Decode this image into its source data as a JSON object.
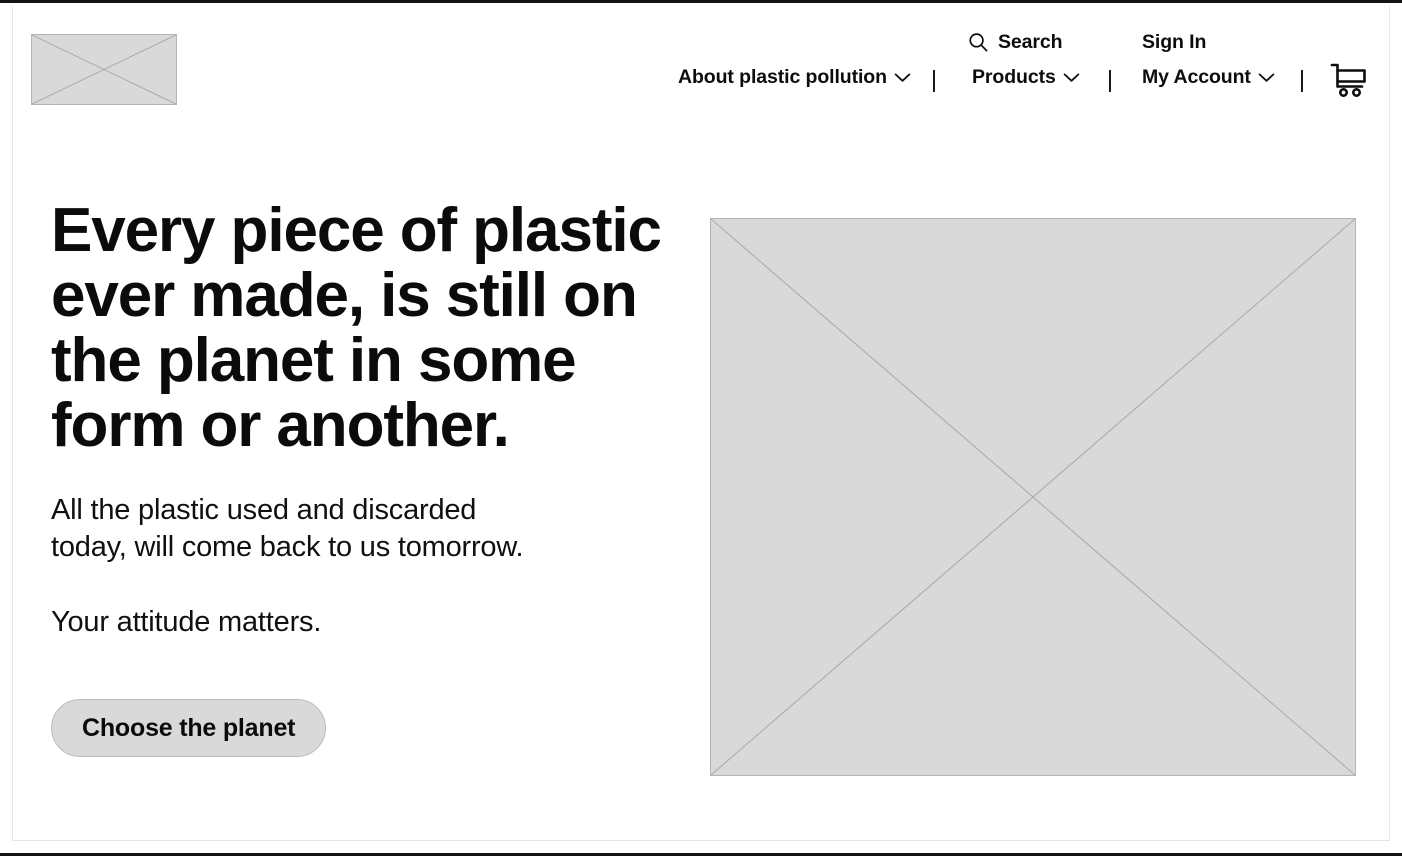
{
  "header": {
    "logo": {
      "name": "logo-image-placeholder",
      "alt": ""
    },
    "nav": {
      "search": {
        "label": "Search",
        "icon": "search-icon"
      },
      "sign_in": {
        "label": "Sign In"
      },
      "about": {
        "label": "About plastic pollution",
        "icon": "chevron-down-icon"
      },
      "products": {
        "label": "Products",
        "icon": "chevron-down-icon"
      },
      "my_account": {
        "label": "My Account",
        "icon": "chevron-down-icon"
      },
      "cart": {
        "label": "",
        "icon": "shopping-cart-icon"
      },
      "separator": "|"
    }
  },
  "hero": {
    "title": "Every piece of plastic ever made, is still on the planet in some form or another.",
    "paragraph_1": "All the plastic used and discarded today, will come back to us tomorrow.",
    "paragraph_2": "Your attitude matters.",
    "cta_label": "Choose the planet",
    "image": {
      "name": "hero-image-placeholder",
      "alt": ""
    }
  },
  "colors": {
    "placeholder_fill": "#d9d9d9",
    "placeholder_border": "#b4b4b4",
    "placeholder_cross": "#a8a8a8",
    "text": "#0b0b0b",
    "page_background": "#ffffff",
    "frame": "#141414"
  }
}
